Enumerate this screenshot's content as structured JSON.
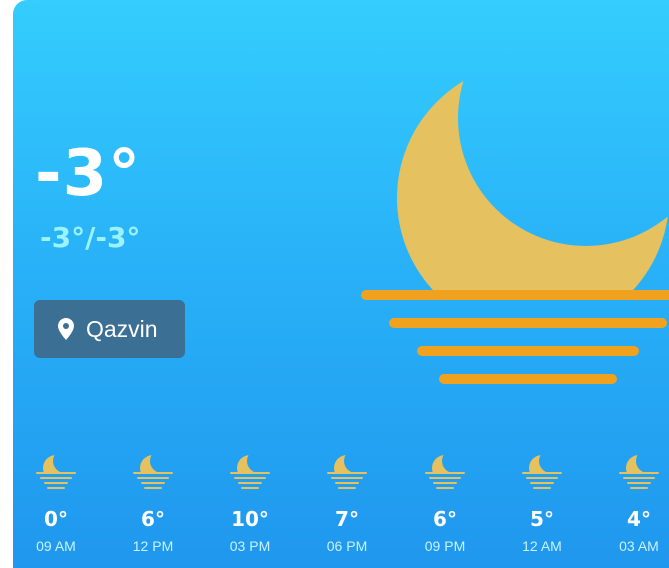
{
  "current": {
    "temperature": "-3°",
    "range": "-3°/-3°",
    "condition_icon": "moon-set-icon"
  },
  "location": {
    "label": "Qazvin",
    "icon": "map-pin-icon"
  },
  "colors": {
    "background_top": "#34cdfd",
    "background_bottom": "#1f97ee",
    "moon": "#e6c15f",
    "horizon_lines": "#f0a21e",
    "range_text": "#9cf3ff",
    "location_button": "#3b6f93"
  },
  "forecast": [
    {
      "temp": "0°",
      "time": "09 AM",
      "icon": "moon-set-icon"
    },
    {
      "temp": "6°",
      "time": "12 PM",
      "icon": "moon-set-icon"
    },
    {
      "temp": "10°",
      "time": "03 PM",
      "icon": "moon-set-icon"
    },
    {
      "temp": "7°",
      "time": "06 PM",
      "icon": "moon-set-icon"
    },
    {
      "temp": "6°",
      "time": "09 PM",
      "icon": "moon-set-icon"
    },
    {
      "temp": "5°",
      "time": "12 AM",
      "icon": "moon-set-icon"
    },
    {
      "temp": "4°",
      "time": "03 AM",
      "icon": "moon-set-icon"
    }
  ]
}
